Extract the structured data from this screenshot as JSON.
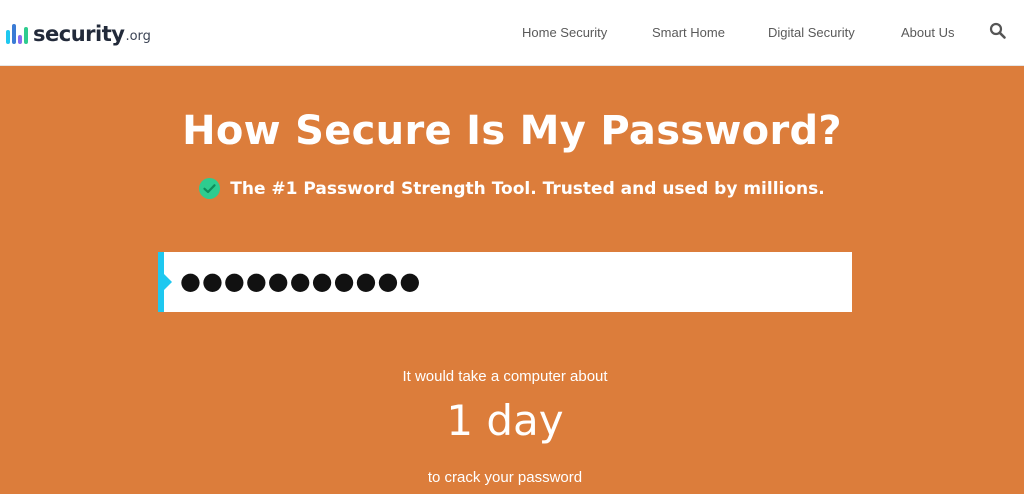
{
  "header": {
    "logo": {
      "brand": "security",
      "tld": ".org"
    },
    "nav": [
      {
        "label": "Home Security"
      },
      {
        "label": "Smart Home"
      },
      {
        "label": "Digital Security"
      },
      {
        "label": "About Us"
      }
    ],
    "search_icon": "search-icon"
  },
  "hero": {
    "title": "How Secure Is My Password?",
    "tagline": "The #1 Password Strength Tool. Trusted and used by millions.",
    "tagline_icon": "check-circle-icon",
    "password_field": {
      "masked_value": "●●●●●●●●●●●",
      "character_count": 11
    },
    "result": {
      "prefix": "It would take a computer about",
      "time": "1 day",
      "suffix": "to crack your password"
    }
  },
  "colors": {
    "hero_background": "#dc7d3b",
    "accent": "#1ec8f0",
    "check_icon": "#2ecc8f",
    "header_text": "#5a5a5a"
  }
}
